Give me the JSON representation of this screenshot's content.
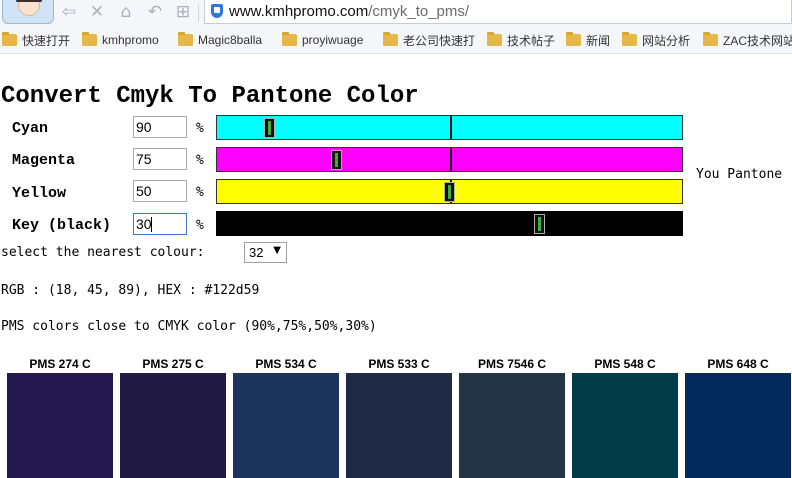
{
  "browser": {
    "url_domain": "www.kmhpromo.com",
    "url_path": "/cmyk_to_pms/",
    "bookmarks": [
      "快速打开",
      "kmhpromo",
      "Magic8balla",
      "proyiwuage",
      "老公司快速打",
      "技术帖子",
      "新闻",
      "网站分析",
      "ZAC技术网站"
    ]
  },
  "page": {
    "title": "Convert Cmyk To Pantone Color",
    "pct_symbol": "%",
    "channels": [
      {
        "label": "Cyan",
        "value": "90",
        "color": "#00ffff",
        "level": 0.9
      },
      {
        "label": "Magenta",
        "value": "75",
        "color": "#ff00ff",
        "level": 0.75
      },
      {
        "label": "Yellow",
        "value": "50",
        "color": "#ffff00",
        "level": 0.5
      },
      {
        "label": "Key (black)",
        "value": "30",
        "color": "#000000",
        "level": 0.3
      }
    ],
    "you_pantone": "You Pantone",
    "select_label": "select the nearest colour:",
    "select_value": "32",
    "rgb_line": "RGB : (18, 45, 89), HEX : #122d59",
    "pms_close_line": "PMS colors close to CMYK color (90%,75%,50%,30%)",
    "swatches": [
      {
        "label": "PMS 274 C",
        "color": "#24184f"
      },
      {
        "label": "PMS 275 C",
        "color": "#211a45"
      },
      {
        "label": "PMS 534 C",
        "color": "#1d355c"
      },
      {
        "label": "PMS 533 C",
        "color": "#1f2a44"
      },
      {
        "label": "PMS 7546 C",
        "color": "#233545"
      },
      {
        "label": "PMS 548 C",
        "color": "#023c49"
      },
      {
        "label": "PMS 648 C",
        "color": "#022b5c"
      }
    ]
  }
}
